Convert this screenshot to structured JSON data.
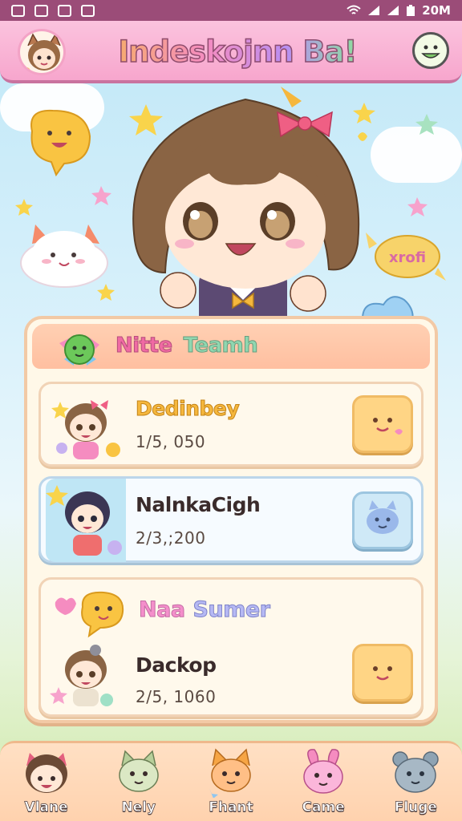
{
  "status_bar": {
    "time": "20M"
  },
  "header": {
    "title": "Indeskojnn Ba!"
  },
  "hero": {
    "sticker_text": "xrofi"
  },
  "team_panel": {
    "title_part1": "Nitte",
    "title_part2": "Teamh",
    "members": [
      {
        "name": "Dedinbey",
        "value": "1/5, 050",
        "name_color": "#f5b73d"
      },
      {
        "name": "NalnkaCigh",
        "value": "2/3,;200",
        "name_color": "#3a2b2b"
      },
      {
        "name": "Dackop",
        "value": "2/5, 1060",
        "name_color": "#3a2b2b"
      }
    ],
    "section": {
      "part1": "Naa",
      "part2": "Sumer"
    }
  },
  "bottom_nav": {
    "items": [
      {
        "label": "Vlane",
        "icon": "girl-avatar-icon"
      },
      {
        "label": "Nely",
        "icon": "green-cat-icon"
      },
      {
        "label": "Fhant",
        "icon": "orange-cat-icon"
      },
      {
        "label": "Came",
        "icon": "pink-bunny-icon"
      },
      {
        "label": "Fluge",
        "icon": "grey-bear-icon"
      }
    ]
  },
  "colors": {
    "status_bar": "#9b4c78",
    "header": "#f7a6cd",
    "panel": "#fff8e8",
    "nav": "#ffd2ae"
  }
}
